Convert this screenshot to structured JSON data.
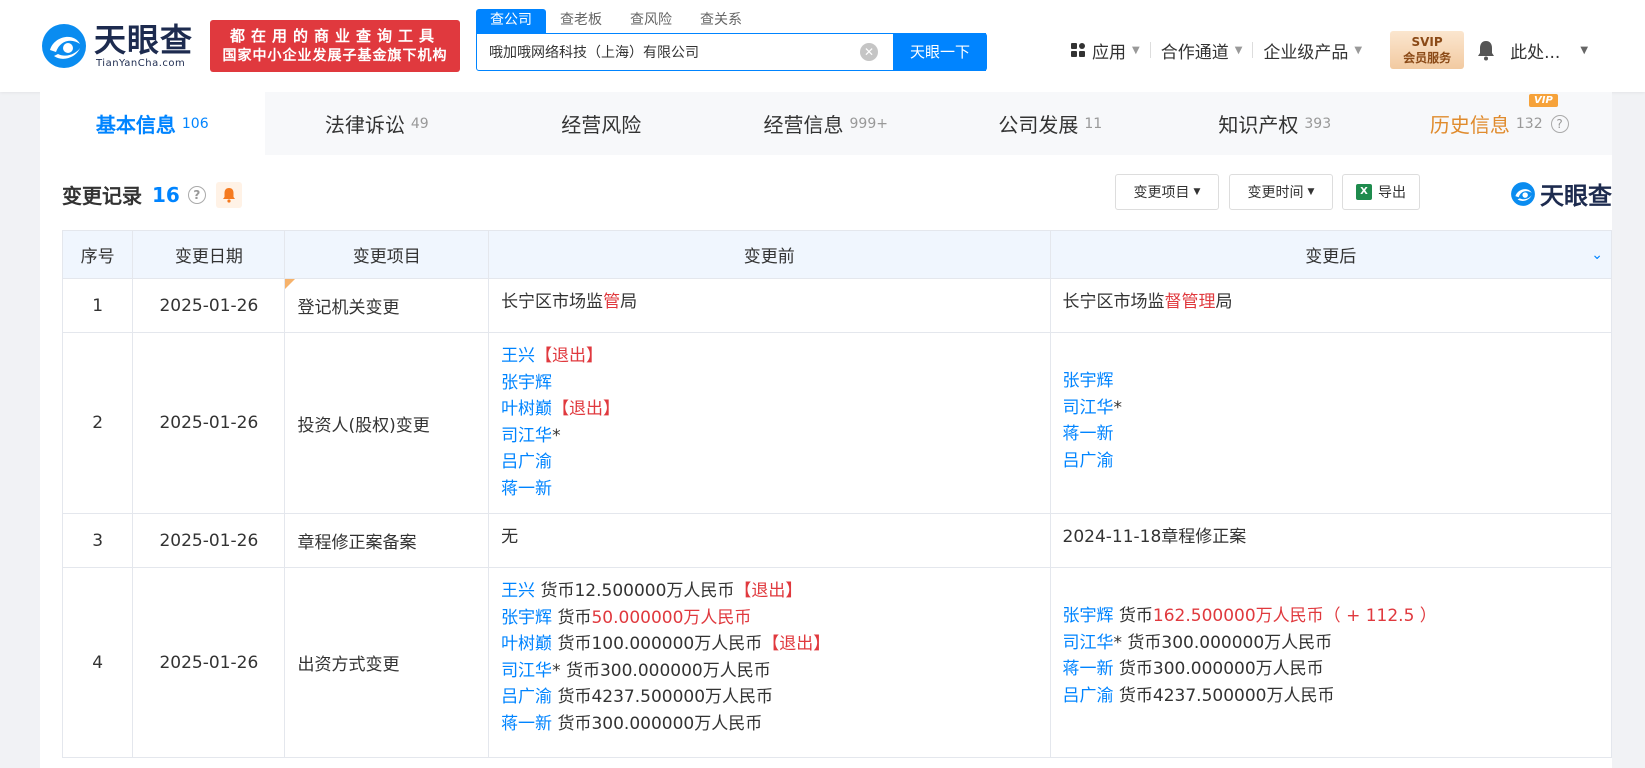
{
  "brand": {
    "name": "天眼查",
    "domain": "TianYanCha.com",
    "slogan_line1": "都在用的商业查询工具",
    "slogan_line2": "国家中小企业发展子基金旗下机构"
  },
  "search": {
    "tabs": [
      "查公司",
      "查老板",
      "查风险",
      "查关系"
    ],
    "active_tab": 0,
    "value": "哦加哦网络科技（上海）有限公司",
    "button_label": "天眼一下"
  },
  "nav": {
    "apps_label": "应用",
    "partner_label": "合作通道",
    "enterprise_label": "企业级产品",
    "svip_line1": "SVIP",
    "svip_line2": "会员服务",
    "user_name": "此处..."
  },
  "tabs": [
    {
      "label": "基本信息",
      "count": "106",
      "active": true
    },
    {
      "label": "法律诉讼",
      "count": "49"
    },
    {
      "label": "经营风险",
      "count": ""
    },
    {
      "label": "经营信息",
      "count": "999+"
    },
    {
      "label": "公司发展",
      "count": "11"
    },
    {
      "label": "知识产权",
      "count": "393"
    },
    {
      "label": "历史信息",
      "count": "132",
      "badge": "VIP"
    }
  ],
  "section": {
    "title": "变更记录",
    "count": "16",
    "filter_item_label": "变更项目",
    "filter_time_label": "变更时间",
    "export_label": "导出",
    "brand_label": "天眼查"
  },
  "table": {
    "headers": {
      "index": "序号",
      "date": "变更日期",
      "item": "变更项目",
      "before": "变更前",
      "after": "变更后"
    },
    "rows": [
      {
        "index": "1",
        "date": "2025-01-26",
        "item": "登记机关变更",
        "before": {
          "p1": "长宁区市场监",
          "hl": "管",
          "p2": "局"
        },
        "after": {
          "p1": "长宁区市场监",
          "hl": "督管理",
          "p2": "局"
        }
      },
      {
        "index": "2",
        "date": "2025-01-26",
        "item": "投资人(股权)变更",
        "before": [
          {
            "name": "王兴",
            "tag": "【退出】"
          },
          {
            "name": "张宇辉",
            "tag": ""
          },
          {
            "name": "叶树巅",
            "tag": "【退出】"
          },
          {
            "name": "司江华",
            "star": "*",
            "tag": ""
          },
          {
            "name": "吕广渝",
            "tag": ""
          },
          {
            "name": "蒋一新",
            "tag": ""
          }
        ],
        "after": [
          {
            "name": "张宇辉"
          },
          {
            "name": "司江华",
            "star": "*"
          },
          {
            "name": "蒋一新"
          },
          {
            "name": "吕广渝"
          }
        ]
      },
      {
        "index": "3",
        "date": "2025-01-26",
        "item": "章程修正案备案",
        "before": "无",
        "after": "2024-11-18章程修正案"
      },
      {
        "index": "4",
        "date": "2025-01-26",
        "item": "出资方式变更",
        "before": [
          {
            "name": "王兴",
            "star": "",
            "prefix": "货币",
            "amount": "12.500000万人民币",
            "highlight": false,
            "tag": "【退出】"
          },
          {
            "name": "张宇辉",
            "star": "",
            "prefix": "货币",
            "amount": "50.000000万人民币",
            "highlight": true,
            "tag": ""
          },
          {
            "name": "叶树巅",
            "star": "",
            "prefix": "货币",
            "amount": "100.000000万人民币",
            "highlight": false,
            "tag": "【退出】"
          },
          {
            "name": "司江华",
            "star": "*",
            "prefix": "货币",
            "amount": "300.000000万人民币",
            "highlight": false,
            "tag": ""
          },
          {
            "name": "吕广渝",
            "star": "",
            "prefix": "货币",
            "amount": "4237.500000万人民币",
            "highlight": false,
            "tag": ""
          },
          {
            "name": "蒋一新",
            "star": "",
            "prefix": "货币",
            "amount": "300.000000万人民币",
            "highlight": false,
            "tag": ""
          }
        ],
        "after": [
          {
            "name": "张宇辉",
            "star": "",
            "prefix": "货币",
            "amount": "162.500000万人民币",
            "highlight": true,
            "delta": "（ + 112.5 ）"
          },
          {
            "name": "司江华",
            "star": "*",
            "prefix": "货币",
            "amount": "300.000000万人民币",
            "highlight": false,
            "delta": ""
          },
          {
            "name": "蒋一新",
            "star": "",
            "prefix": "货币",
            "amount": "300.000000万人民币",
            "highlight": false,
            "delta": ""
          },
          {
            "name": "吕广渝",
            "star": "",
            "prefix": "货币",
            "amount": "4237.500000万人民币",
            "highlight": false,
            "delta": ""
          }
        ]
      }
    ]
  },
  "colors": {
    "accent": "#0084ff",
    "highlight": "#e0393e",
    "vip": "#e08b2d"
  }
}
